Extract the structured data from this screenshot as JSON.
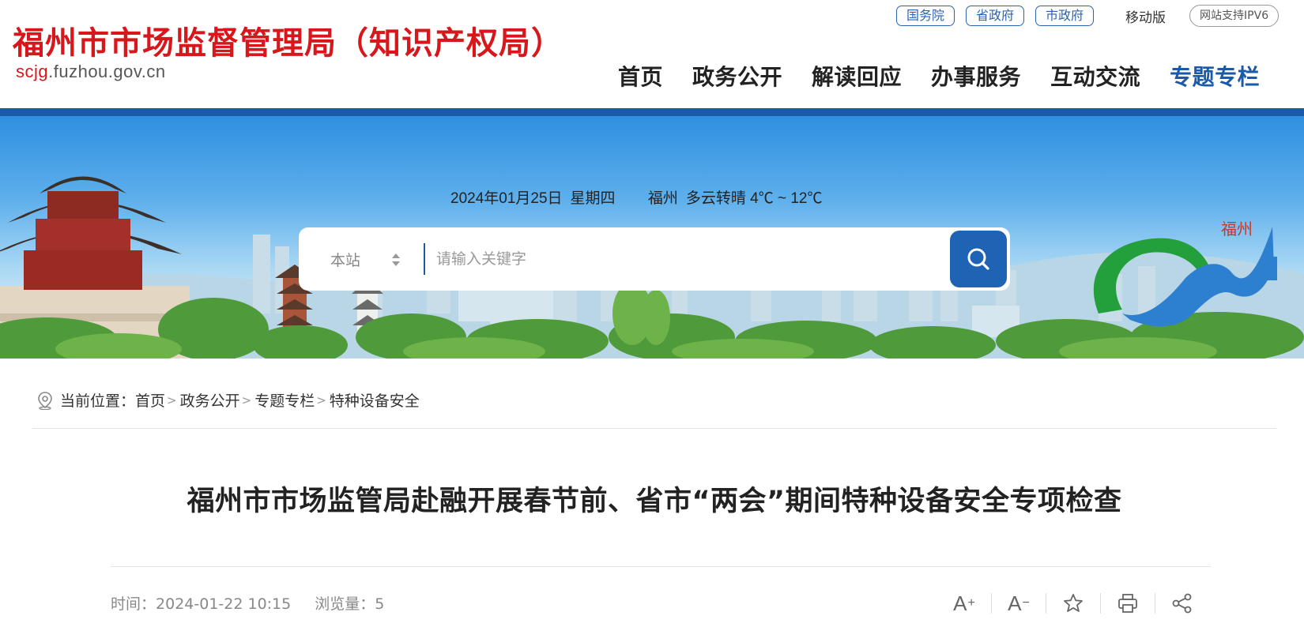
{
  "header": {
    "site_title": "福州市市场监督管理局（知识产权局）",
    "domain_highlight": "scjg",
    "domain_rest": ".fuzhou.gov.cn",
    "top_links": [
      "国务院",
      "省政府",
      "市政府"
    ],
    "mobile_label": "移动版",
    "ipv6_label": "网站支持IPV6",
    "nav": [
      "首页",
      "政务公开",
      "解读回应",
      "办事服务",
      "互动交流",
      "专题专栏"
    ],
    "active_nav": "专题专栏"
  },
  "banner": {
    "date": "2024年01月25日",
    "weekday": "星期四",
    "weather_city": "福州",
    "weather": "多云转晴 4℃ ~ 12℃",
    "search": {
      "scope": "本站",
      "placeholder": "请输入关键字"
    },
    "emblem_text": "福州"
  },
  "breadcrumb": {
    "label": "当前位置：",
    "items": [
      "首页",
      "政务公开",
      "专题专栏",
      "特种设备安全"
    ],
    "separator": ">"
  },
  "article": {
    "title": "福州市市场监管局赴融开展春节前、省市“两会”期间特种设备安全专项检查",
    "time_label": "时间：",
    "time": "2024-01-22 10:15",
    "views_label": "浏览量：",
    "views": "5"
  },
  "tools": {
    "font_up": "A",
    "font_down": "A",
    "icons": [
      "font-increase-icon",
      "font-decrease-icon",
      "star-icon",
      "print-icon",
      "share-icon"
    ]
  },
  "colors": {
    "brand_red": "#d7171b",
    "brand_blue": "#1a5ba8",
    "search_button": "#1f63b4"
  }
}
